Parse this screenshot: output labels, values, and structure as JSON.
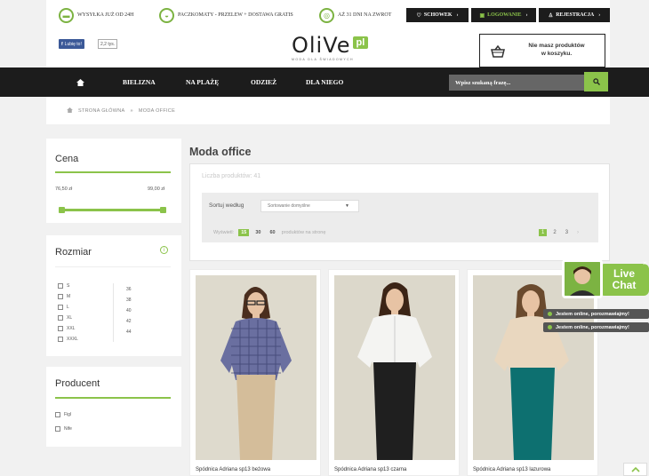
{
  "topbar": {
    "shipping": "WYSYŁKA JUŻ OD 24H",
    "lockers": "PACZKOMATY - PRZELEW + DOSTAWA GRATIS",
    "returns": "AŻ 31 DNI NA ZWROT",
    "wishlist": "SCHOWEK",
    "login": "LOGOWANIE",
    "register": "REJESTRACJA"
  },
  "header": {
    "fb_like": "Lubię to!",
    "fb_count": "2,2 tys.",
    "logo": "OliVe",
    "logo_suffix": "pl",
    "logo_tagline": "MODA DLA ŚWIADOMYCH",
    "cart_text": "Nie masz produktów\nw koszyku."
  },
  "nav": {
    "items": [
      "BIELIZNA",
      "NA PLAŻĘ",
      "ODZIEŻ",
      "DLA NIEGO"
    ],
    "search_placeholder": "Wpisz szukaną frazę..."
  },
  "breadcrumb": {
    "home": "STRONA GŁÓWNA",
    "sep": "»",
    "current": "MODA OFFICE"
  },
  "filters": {
    "price": {
      "title": "Cena",
      "min": "76,50 zł",
      "max": "99,00 zł"
    },
    "size": {
      "title": "Rozmiar",
      "options": [
        "S",
        "M",
        "L",
        "XL",
        "XXL",
        "XXXL"
      ],
      "numbers": [
        "36",
        "38",
        "40",
        "42",
        "44"
      ]
    },
    "producer": {
      "title": "Producent",
      "options": [
        "Figl",
        "Nife"
      ]
    }
  },
  "listing": {
    "title": "Moda office",
    "count_label": "Liczba produktów: 41",
    "sort_label": "Sortuj według",
    "sort_value": "Sortowanie domyślne",
    "show_label": "Wyświetl:",
    "per_page": [
      "15",
      "30",
      "60"
    ],
    "per_page_suffix": "produktów na stronę",
    "pages": [
      "1",
      "2",
      "3"
    ],
    "next": "›"
  },
  "products": [
    {
      "name": "Spódnica Adriana sp13 beżowa",
      "skirt_color": "#d4bd9a",
      "shirt": "check"
    },
    {
      "name": "Spódnica Adriana sp13 czarna",
      "skirt_color": "#1f1f1f",
      "shirt": "white"
    },
    {
      "name": "Spódnica Adriana sp13 lazurowa",
      "skirt_color": "#0d7070",
      "shirt": "cream"
    }
  ],
  "livechat": {
    "title": "Live\nChat",
    "close": "×",
    "status": "Jestem online, porozmawiajmy!"
  },
  "colors": {
    "accent": "#8bc34a",
    "dark": "#1c1c1c"
  }
}
